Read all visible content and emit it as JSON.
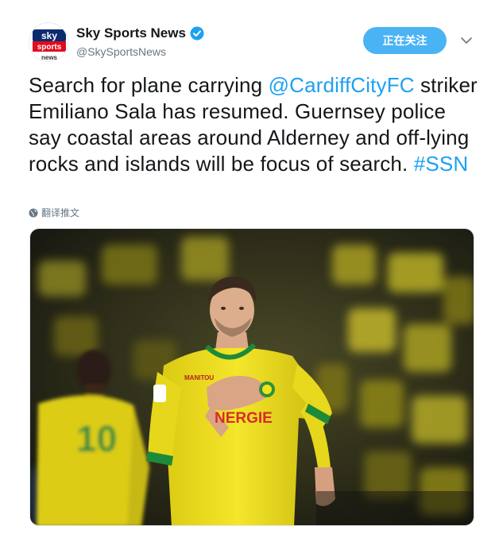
{
  "header": {
    "display_name": "Sky Sports News",
    "handle": "@SkySportsNews",
    "follow_label": "正在关注",
    "avatar_logo": {
      "line1": "sky",
      "line2": "sports",
      "line3": "news"
    }
  },
  "tweet": {
    "text_1": "Search for plane carrying ",
    "mention": "@CardiffCityFC",
    "text_2": " striker Emiliano Sala has resumed. Guernsey police say coastal areas around Alderney and off-lying rocks and islands will be focus of search. ",
    "hashtag": "#SSN",
    "translate_label": "翻译推文"
  },
  "media": {
    "shirt_sponsor": "NERGIE",
    "shirt_maker": "MANITOU",
    "back_number": "10"
  },
  "colors": {
    "accent": "#1da1f2",
    "follow_bg": "#4ab3f4",
    "kit_yellow": "#f2e41a",
    "kit_green": "#1d8a3a"
  },
  "icons": [
    "verified-badge-icon",
    "chevron-down-icon",
    "globe-icon"
  ]
}
